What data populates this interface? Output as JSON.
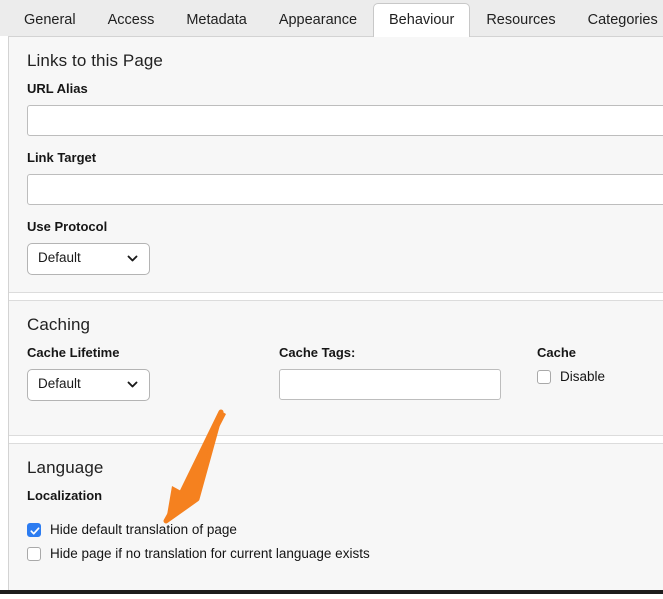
{
  "tabs": [
    {
      "label": "General",
      "active": false
    },
    {
      "label": "Access",
      "active": false
    },
    {
      "label": "Metadata",
      "active": false
    },
    {
      "label": "Appearance",
      "active": false
    },
    {
      "label": "Behaviour",
      "active": true
    },
    {
      "label": "Resources",
      "active": false
    },
    {
      "label": "Categories",
      "active": false
    }
  ],
  "links_section": {
    "title": "Links to this Page",
    "url_alias": {
      "label": "URL Alias",
      "value": "",
      "placeholder": ""
    },
    "link_target": {
      "label": "Link Target",
      "value": "",
      "placeholder": ""
    },
    "use_protocol": {
      "label": "Use Protocol",
      "selected": "Default",
      "icon": "chevron-down-icon"
    }
  },
  "caching_section": {
    "title": "Caching",
    "cache_lifetime": {
      "label": "Cache Lifetime",
      "selected": "Default",
      "icon": "chevron-down-icon"
    },
    "cache_tags": {
      "label": "Cache Tags:",
      "value": "",
      "placeholder": ""
    },
    "cache": {
      "label": "Cache",
      "checkbox_label": "Disable",
      "checked": false
    }
  },
  "language_section": {
    "title": "Language",
    "subtitle": "Localization",
    "options": [
      {
        "label": "Hide default translation of page",
        "checked": true
      },
      {
        "label": "Hide page if no translation for current language exists",
        "checked": false
      }
    ]
  },
  "annotation": {
    "type": "arrow",
    "color": "#f5811f",
    "points_to": "Hide default translation of page"
  }
}
